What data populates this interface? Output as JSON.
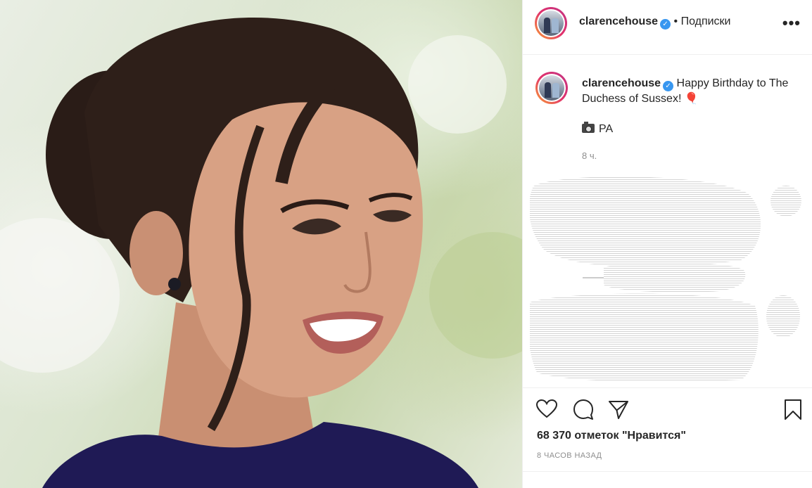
{
  "post": {
    "author": "clarencehouse",
    "follow_label": "• Подписки",
    "more_label": "•••",
    "verified_glyph": "✓"
  },
  "caption": {
    "author": "clarencehouse",
    "text": "Happy Birthday to The Duchess of Sussex! 🎈",
    "credit": "PA",
    "time_short": "8 ч."
  },
  "engagement": {
    "likes": "68 370 отметок \"Нравится\"",
    "time_ago": "8 ЧАСОВ НАЗАД"
  },
  "icons": {
    "like": "heart-icon",
    "comment": "comment-icon",
    "share": "share-icon",
    "save": "bookmark-icon",
    "more": "more-icon",
    "camera": "camera-icon",
    "verified": "verified-icon"
  },
  "colors": {
    "verified": "#3897f0",
    "text": "#262626",
    "muted": "#8e8e8e",
    "border": "#efefef"
  }
}
